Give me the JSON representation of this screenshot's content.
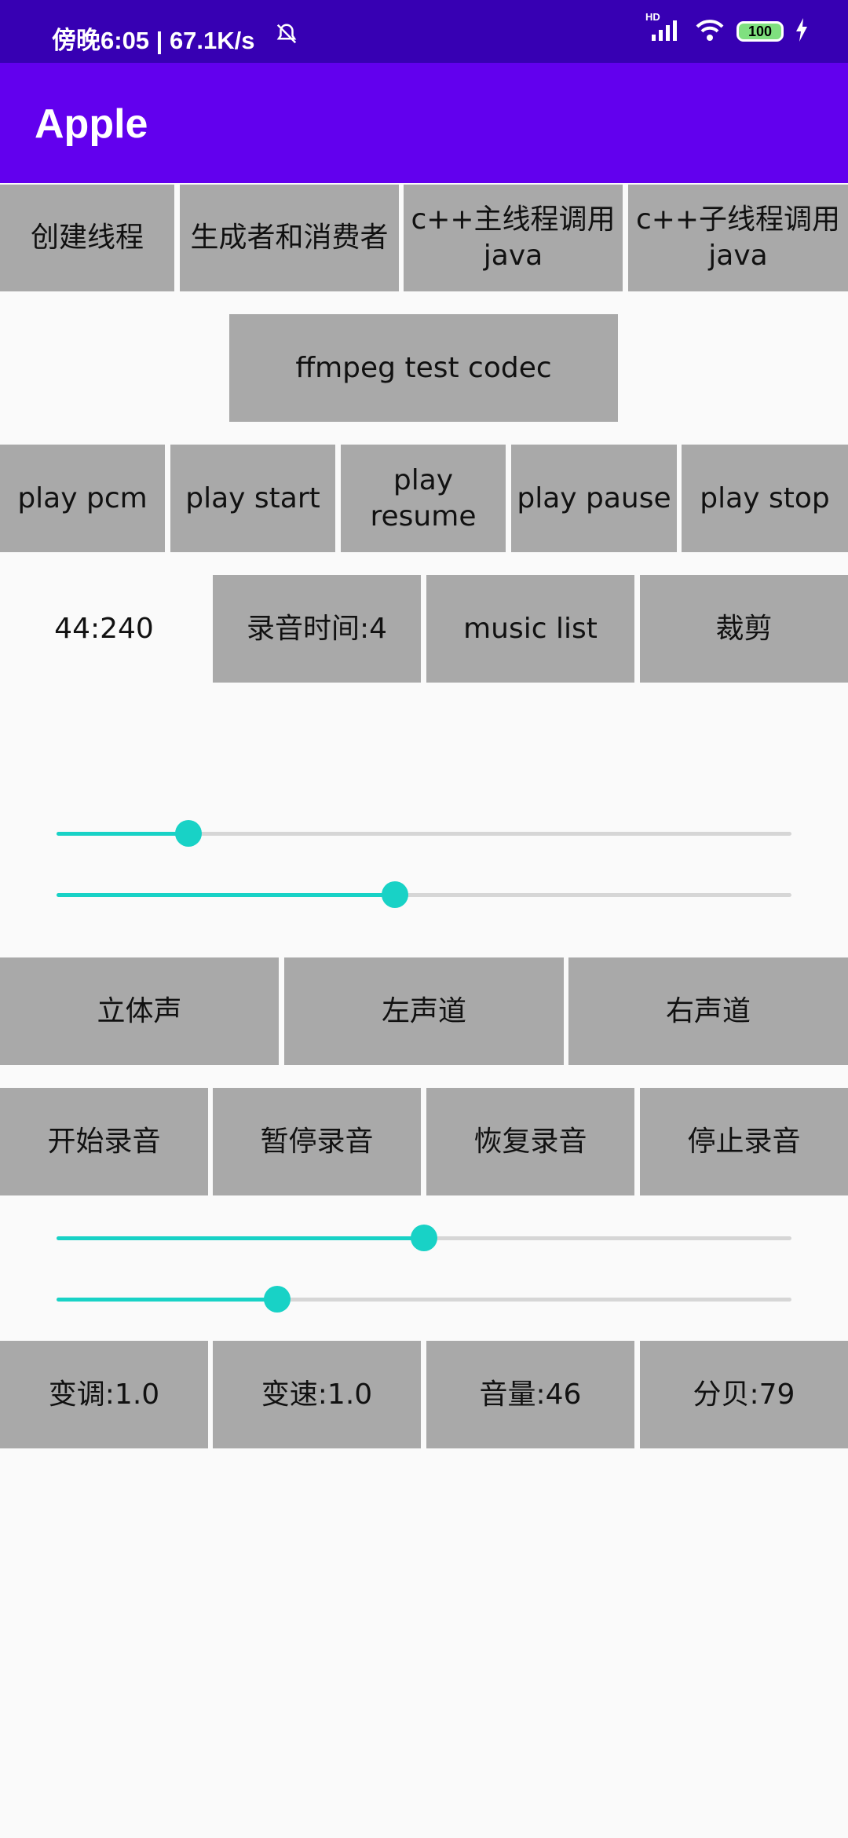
{
  "status_bar": {
    "time_speed": "傍晚6:05 | 67.1K/s",
    "network_label": "HD",
    "battery": "100"
  },
  "app_bar": {
    "title": "Apple"
  },
  "thread_row": [
    "创建线程",
    "生成者和消费者",
    "c++主线程调用java",
    "c++子线程调用java"
  ],
  "ffmpeg_button": "ffmpeg test codec",
  "play_row": [
    "play pcm",
    "play start",
    "play resume",
    "play pause",
    "play stop"
  ],
  "time_row": {
    "time_value": "44:240",
    "buttons": [
      "录音时间:4",
      "music list",
      "裁剪"
    ]
  },
  "sliders_top": [
    {
      "name": "progress-slider-1",
      "value": 0.18
    },
    {
      "name": "progress-slider-2",
      "value": 0.46
    }
  ],
  "channel_row": [
    "立体声",
    "左声道",
    "右声道"
  ],
  "record_row": [
    "开始录音",
    "暂停录音",
    "恢复录音",
    "停止录音"
  ],
  "sliders_bottom": [
    {
      "name": "pitch-slider",
      "value": 0.5
    },
    {
      "name": "speed-slider",
      "value": 0.3
    }
  ],
  "param_row": [
    "变调:1.0",
    "变速:1.0",
    "音量:46",
    "分贝:79"
  ],
  "colors": {
    "status_bar": "#3700b3",
    "app_bar": "#6200ee",
    "button": "#a9a9a9",
    "slider_accent": "#18d2c6",
    "slider_track": "#d6d6d6"
  }
}
